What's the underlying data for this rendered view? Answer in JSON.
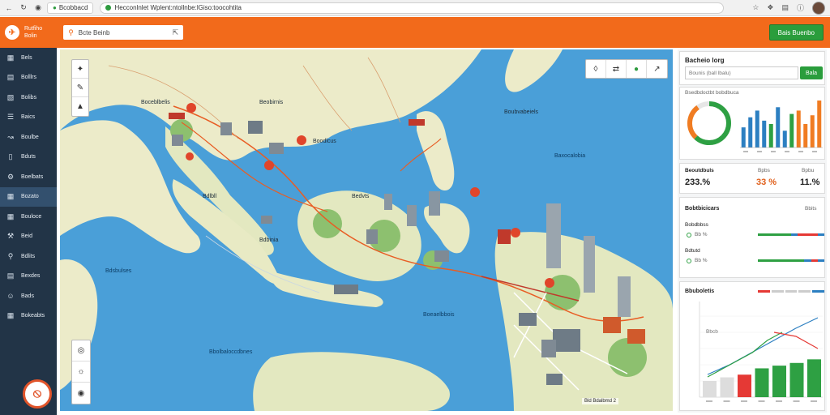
{
  "browser": {
    "tab_title": "Bcobbacd",
    "url": "Hecconlnlet Wplent:ntollnbe:lGiso:toocohtita"
  },
  "app": {
    "name": "Rutfiho",
    "subtitle": "Bolin",
    "search_text": "Bcte Beinb",
    "header_action": "Bais Buenbo"
  },
  "sidebar": {
    "items": [
      {
        "label": "Bels",
        "icon": "dashboard-icon"
      },
      {
        "label": "Bolllrs",
        "icon": "layers-icon"
      },
      {
        "label": "Bolibs",
        "icon": "briefcase-icon"
      },
      {
        "label": "Baics",
        "icon": "list-icon"
      },
      {
        "label": "Boulbe",
        "icon": "route-icon"
      },
      {
        "label": "Bduts",
        "icon": "document-icon"
      },
      {
        "label": "Boelbats",
        "icon": "settings-icon"
      },
      {
        "label": "Bozato",
        "icon": "map-icon"
      },
      {
        "label": "Bouloce",
        "icon": "grid-icon"
      },
      {
        "label": "Beid",
        "icon": "tools-icon"
      },
      {
        "label": "Bdlits",
        "icon": "user-icon"
      },
      {
        "label": "Bexdes",
        "icon": "table-icon"
      },
      {
        "label": "Bads",
        "icon": "person-icon"
      },
      {
        "label": "Bokeabts",
        "icon": "calendar-icon"
      }
    ],
    "active_index": 7
  },
  "map": {
    "labels": [
      {
        "text": "Boceblbelis"
      },
      {
        "text": "Beobirnis"
      },
      {
        "text": "Boodlcus"
      },
      {
        "text": "Bdlbll"
      },
      {
        "text": "Bedvts"
      },
      {
        "text": "Boubvabeiels"
      },
      {
        "text": "Baxocalobia"
      },
      {
        "text": "Bdbinia"
      },
      {
        "text": "Bdsbulses"
      },
      {
        "text": "Boeaelbbois"
      },
      {
        "text": "Bbolbaloccdbnes"
      }
    ],
    "scale_text": "Bld Bdalbmd 2"
  },
  "panel": {
    "card1": {
      "title": "Bacheio lorg",
      "placeholder": "Bounis (ball lbalu)",
      "button": "Bala"
    },
    "card2": {
      "subtitle": "Bsedbdoctbt bobdbuca",
      "donut_percent": 62,
      "bars": [
        30,
        45,
        55,
        40,
        35,
        60,
        25,
        50,
        55,
        35,
        48,
        70
      ],
      "bar_colors": [
        "#2c7fc1",
        "#2c7fc1",
        "#2c7fc1",
        "#2c7fc1",
        "#2ea043",
        "#2c7fc1",
        "#2c7fc1",
        "#2ea043",
        "#f07c22",
        "#f07c22",
        "#f07c22",
        "#f07c22"
      ],
      "donut_colors": {
        "main": "#2ea043",
        "accent": "#f07c22",
        "track": "#e6e6e6"
      }
    },
    "card3": {
      "headers": [
        "Beoutdbuls",
        "Bpbs",
        "Bpbu"
      ],
      "values": [
        "233.%",
        "33 %",
        "11.%"
      ],
      "value_colors": [
        "#222222",
        "#e0601c",
        "#222222"
      ]
    },
    "card4": {
      "title": "Bobtbicicars",
      "tag": "Bbits",
      "rows": [
        {
          "label": "Bobdbbss",
          "value": "Bb %"
        },
        {
          "label": "Bdtutd",
          "value": "Bb %"
        }
      ]
    },
    "card5": {
      "title": "Bbuboletis",
      "subtitle": "Bbcb",
      "bars": [
        18,
        22,
        25,
        32,
        35,
        38,
        42
      ],
      "bar_colors": [
        "#dddddd",
        "#dddddd",
        "#e53935",
        "#2ea043",
        "#2ea043",
        "#2ea043",
        "#2ea043"
      ],
      "line_green": [
        5,
        15,
        25,
        35,
        50,
        60
      ],
      "line_blue": [
        8,
        20,
        35,
        50,
        65,
        78
      ],
      "line_red": [
        60,
        55,
        40
      ]
    }
  }
}
